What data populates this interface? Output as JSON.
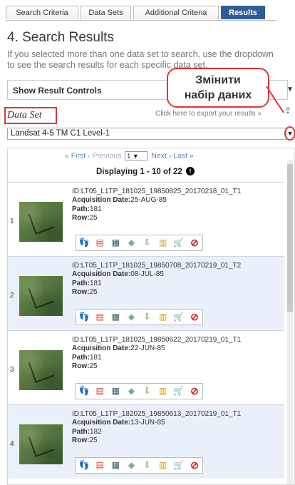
{
  "tabs": [
    {
      "label": "Search Criteria"
    },
    {
      "label": "Data Sets"
    },
    {
      "label": "Additional Critena"
    },
    {
      "label": "Results",
      "active": true
    }
  ],
  "heading": "4. Search Results",
  "intro": "If you selected more than one data set to search, use the dropdown to see the search results for each specific data set.",
  "result_controls": {
    "label": "Show Result Controls"
  },
  "callout": {
    "line1": "Змінити",
    "line2": "набір даних"
  },
  "data_set": {
    "label": "Data Set",
    "export_link": "Click here to export your results »",
    "selected": "Landsat 4-5 TM C1 Level-1"
  },
  "pagination": {
    "first": "« First",
    "previous": "‹ Previous",
    "page": "1",
    "next": "Next ›",
    "last": "Last »",
    "status": "Displaying 1 - 10 of 22"
  },
  "results": [
    {
      "num": "1",
      "id": "ID:LT05_L1TP_181025_19850825_20170218_01_T1",
      "acq_label": "Acquisition Date:",
      "acq_value": "25-AUG-85",
      "path_label": "Path:",
      "path_value": "181",
      "row_label": "Row:",
      "row_value": "25"
    },
    {
      "num": "2",
      "id": "ID:LT05_L1TP_181025_19850708_20170219_01_T2",
      "acq_label": "Acquisition Date:",
      "acq_value": "08-JUL-85",
      "path_label": "Path:",
      "path_value": "181",
      "row_label": "Row:",
      "row_value": "25"
    },
    {
      "num": "3",
      "id": "ID:LT05_L1TP_181025_19850622_20170219_01_T1",
      "acq_label": "Acquisition Date:",
      "acq_value": "22-JUN-85",
      "path_label": "Path:",
      "path_value": "181",
      "row_label": "Row:",
      "row_value": "25"
    },
    {
      "num": "4",
      "id": "ID:LT05_L1TP_182025_19850613_20170219_01_T1",
      "acq_label": "Acquisition Date:",
      "acq_value": "13-JUN-85",
      "path_label": "Path:",
      "path_value": "182",
      "row_label": "Row:",
      "row_value": "25"
    }
  ],
  "action_icons": [
    "footprint-icon",
    "overlay-icon",
    "compare-icon",
    "metadata-icon",
    "download-icon",
    "bulk-download-icon",
    "order-icon",
    "exclude-icon"
  ],
  "colors": {
    "active_tab": "#2f5d96",
    "highlight": "#e53434",
    "alt_row": "#e9f0fa"
  }
}
